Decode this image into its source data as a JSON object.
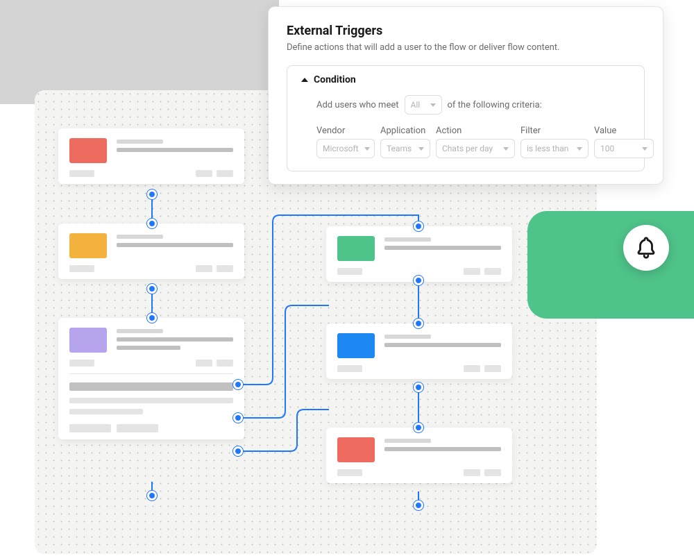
{
  "panel": {
    "title": "External Triggers",
    "description": "Define actions that will add a user to the flow or deliver flow content.",
    "condition_label": "Condition",
    "criteria_prefix": "Add users who meet",
    "criteria_suffix": "of the following criteria:",
    "all_select": "All",
    "fields": {
      "vendor": {
        "label": "Vendor",
        "value": "Microsoft"
      },
      "application": {
        "label": "Application",
        "value": "Teams"
      },
      "action": {
        "label": "Action",
        "value": "Chats per day"
      },
      "filter": {
        "label": "Filter",
        "value": "is less than"
      },
      "value": {
        "label": "Value",
        "value": "100"
      }
    }
  },
  "nodes": {
    "n1": {
      "color": "#ed6a5e"
    },
    "n2": {
      "color": "#f4b23e"
    },
    "n3": {
      "color": "#b6a4ec"
    },
    "n4": {
      "color": "#4fc48a"
    },
    "n5": {
      "color": "#1e88f2"
    },
    "n6": {
      "color": "#ed6a5e"
    }
  },
  "icons": {
    "bell": "bell"
  }
}
